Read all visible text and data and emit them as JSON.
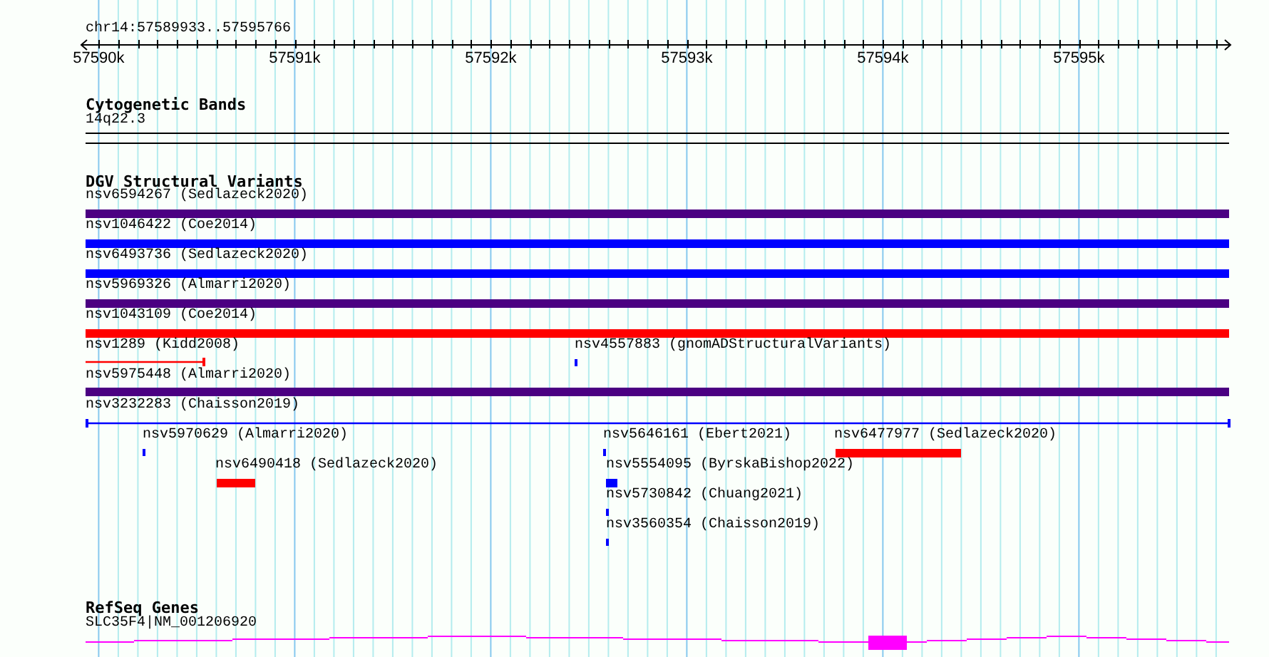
{
  "ruler": {
    "location": "chr14:57589933..57595766",
    "tick_labels": [
      "57590k",
      "57591k",
      "57592k",
      "57593k",
      "57594k",
      "57595k"
    ]
  },
  "tracks": [
    {
      "kind": "bands",
      "title": "Cytogenetic Bands",
      "features": [
        {
          "label": "14q22.3"
        }
      ]
    },
    {
      "kind": "variants",
      "title": "DGV Structural Variants",
      "features": [
        {
          "label": "nsv6594267 (Sedlazeck2020)",
          "kind": "bar",
          "color": "#4b0082"
        },
        {
          "label": "nsv1046422 (Coe2014)",
          "kind": "bar",
          "color": "#0000ff"
        },
        {
          "label": "nsv6493736 (Sedlazeck2020)",
          "kind": "bar",
          "color": "#0000ff"
        },
        {
          "label": "nsv5969326 (Almarri2020)",
          "kind": "bar",
          "color": "#4b0082"
        },
        {
          "label": "nsv1043109 (Coe2014)",
          "kind": "bar",
          "color": "#ff0000"
        },
        {
          "label": "nsv1289 (Kidd2008)",
          "kind": "line",
          "color": "#ff0000"
        },
        {
          "label": "nsv4557883 (gnomADStructuralVariants)",
          "kind": "bar",
          "color": "#0000ff"
        },
        {
          "label": "nsv5975448 (Almarri2020)",
          "kind": "bar",
          "color": "#4b0082"
        },
        {
          "label": "nsv3232283 (Chaisson2019)",
          "kind": "line",
          "color": "#0000ff"
        },
        {
          "label": "nsv5970629 (Almarri2020)",
          "kind": "bar",
          "color": "#0000ff"
        },
        {
          "label": "nsv6490418 (Sedlazeck2020)",
          "kind": "bar",
          "color": "#ff0000"
        },
        {
          "label": "nsv5646161 (Ebert2021)",
          "kind": "bar",
          "color": "#0000ff"
        },
        {
          "label": "nsv6477977 (Sedlazeck2020)",
          "kind": "bar",
          "color": "#ff0000"
        },
        {
          "label": "nsv5554095 (ByrskaBishop2022)",
          "kind": "bar",
          "color": "#0000ff"
        },
        {
          "label": "nsv5730842 (Chuang2021)",
          "kind": "bar",
          "color": "#0000ff"
        },
        {
          "label": "nsv3560354 (Chaisson2019)",
          "kind": "bar",
          "color": "#0000ff"
        }
      ]
    },
    {
      "kind": "genes",
      "title": "RefSeq Genes",
      "features": [
        {
          "label": "SLC35F4|NM_001206920"
        }
      ]
    }
  ]
}
